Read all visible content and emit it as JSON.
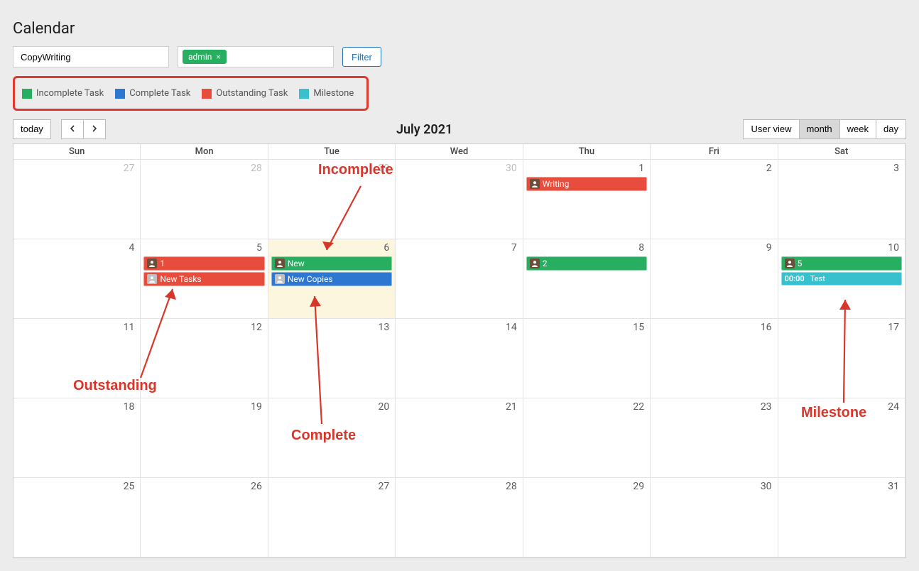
{
  "title": "Calendar",
  "filters": {
    "project_value": "CopyWriting",
    "user_tag": "admin",
    "filter_label": "Filter"
  },
  "legend": {
    "incomplete": "Incomplete Task",
    "complete": "Complete Task",
    "outstanding": "Outstanding Task",
    "milestone": "Milestone"
  },
  "toolbar": {
    "today": "today",
    "title": "July 2021",
    "views": {
      "user": "User view",
      "month": "month",
      "week": "week",
      "day": "day"
    }
  },
  "day_names": [
    "Sun",
    "Mon",
    "Tue",
    "Wed",
    "Thu",
    "Fri",
    "Sat"
  ],
  "weeks": [
    {
      "days": [
        {
          "n": "27",
          "other": true
        },
        {
          "n": "28",
          "other": true
        },
        {
          "n": "29",
          "other": true
        },
        {
          "n": "30",
          "other": true
        },
        {
          "n": "1",
          "events": [
            {
              "kind": "red",
              "label": "Writing",
              "avatar": "photo"
            }
          ]
        },
        {
          "n": "2"
        },
        {
          "n": "3"
        }
      ]
    },
    {
      "days": [
        {
          "n": "4"
        },
        {
          "n": "5",
          "events": [
            {
              "kind": "red",
              "label": "1",
              "avatar": "photo"
            },
            {
              "kind": "red",
              "label": "New Tasks",
              "avatar": "blank"
            }
          ]
        },
        {
          "n": "6",
          "hl": true,
          "events": [
            {
              "kind": "green",
              "label": "New",
              "avatar": "photo"
            },
            {
              "kind": "blue",
              "label": "New Copies",
              "avatar": "blank"
            }
          ]
        },
        {
          "n": "7"
        },
        {
          "n": "8",
          "events": [
            {
              "kind": "green",
              "label": "2",
              "avatar": "photo"
            }
          ]
        },
        {
          "n": "9"
        },
        {
          "n": "10",
          "events": [
            {
              "kind": "green",
              "label": "5",
              "avatar": "photo"
            },
            {
              "kind": "cyan",
              "time": "00:00",
              "label": "Test"
            }
          ]
        }
      ]
    },
    {
      "days": [
        {
          "n": "11"
        },
        {
          "n": "12"
        },
        {
          "n": "13"
        },
        {
          "n": "14"
        },
        {
          "n": "15"
        },
        {
          "n": "16"
        },
        {
          "n": "17"
        }
      ]
    },
    {
      "days": [
        {
          "n": "18"
        },
        {
          "n": "19"
        },
        {
          "n": "20"
        },
        {
          "n": "21"
        },
        {
          "n": "22"
        },
        {
          "n": "23"
        },
        {
          "n": "24"
        }
      ]
    },
    {
      "days": [
        {
          "n": "25"
        },
        {
          "n": "26"
        },
        {
          "n": "27"
        },
        {
          "n": "28"
        },
        {
          "n": "29"
        },
        {
          "n": "30"
        },
        {
          "n": "31"
        }
      ]
    }
  ],
  "annotations": {
    "incomplete": "Incomplete",
    "outstanding": "Outstanding",
    "complete": "Complete",
    "milestone": "Milestone"
  }
}
